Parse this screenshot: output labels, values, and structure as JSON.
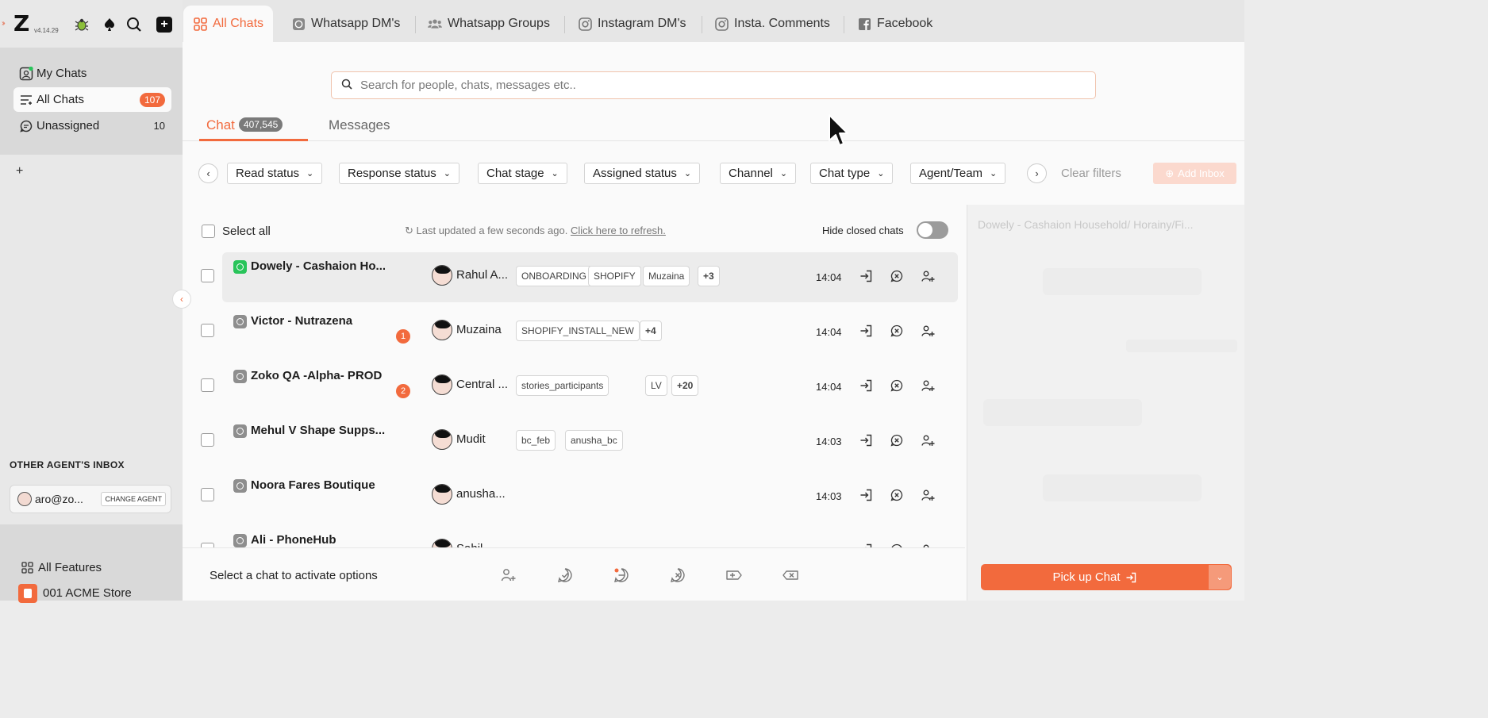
{
  "app": {
    "version": "v4.14.29",
    "accent": "#f26a3d"
  },
  "tabs": [
    {
      "label": "All Chats",
      "icon": "grid-icon",
      "active": true
    },
    {
      "label": "Whatsapp DM's",
      "icon": "whatsapp-icon"
    },
    {
      "label": "Whatsapp Groups",
      "icon": "group-icon"
    },
    {
      "label": "Instagram DM's",
      "icon": "instagram-icon"
    },
    {
      "label": "Insta. Comments",
      "icon": "instagram-icon"
    },
    {
      "label": "Facebook",
      "icon": "facebook-icon"
    }
  ],
  "sidebar": {
    "items": [
      {
        "label": "My Chats",
        "count": ""
      },
      {
        "label": "All Chats",
        "count": "107"
      },
      {
        "label": "Unassigned",
        "count": "10"
      }
    ],
    "add_label": "+",
    "other_inbox_title": "OTHER AGENT'S INBOX",
    "agent_email": "aro@zo...",
    "change_agent": "CHANGE AGENT",
    "all_features": "All Features",
    "store": "001 ACME Store"
  },
  "search": {
    "placeholder": "Search for people, chats, messages etc.."
  },
  "subtabs": {
    "chat": "Chat",
    "chat_count": "407,545",
    "messages": "Messages"
  },
  "filters": {
    "items": [
      "Read status",
      "Response status",
      "Chat stage",
      "Assigned status",
      "Channel",
      "Chat type",
      "Agent/Team"
    ],
    "clear": "Clear filters",
    "add_inbox": "Add Inbox"
  },
  "list": {
    "select_all": "Select all",
    "last_updated": "Last updated a few seconds ago.",
    "refresh": "Click here to refresh.",
    "hide_closed": "Hide closed chats"
  },
  "rows": [
    {
      "name": "Dowely - Cashaion Ho...",
      "channel": "whatsapp",
      "unread": "",
      "agent": "Rahul A...",
      "tags": [
        "ONBOARDING",
        "SHOPIFY",
        "Muzaina",
        "+3"
      ],
      "time": "14:04"
    },
    {
      "name": "Victor - Nutrazena",
      "channel": "whatsapp-grey",
      "unread": "1",
      "agent": "Muzaina",
      "tags": [
        "SHOPIFY_INSTALL_NEW",
        "+4"
      ],
      "time": "14:04"
    },
    {
      "name": "Zoko QA -Alpha- PROD",
      "channel": "whatsapp-grey",
      "unread": "2",
      "agent": "Central ...",
      "tags": [
        "stories_participants",
        "LV",
        "+20"
      ],
      "time": "14:04"
    },
    {
      "name": "Mehul V Shape Supps...",
      "channel": "whatsapp-grey",
      "unread": "",
      "agent": "Mudit",
      "tags": [
        "bc_feb",
        "anusha_bc"
      ],
      "time": "14:03"
    },
    {
      "name": "Noora Fares Boutique",
      "channel": "whatsapp-grey",
      "unread": "",
      "agent": "anusha...",
      "tags": [],
      "time": "14:03"
    },
    {
      "name": "Ali - PhoneHub",
      "channel": "whatsapp-grey",
      "unread": "",
      "agent": "Sahil",
      "tags": [],
      "time": ""
    }
  ],
  "bottom": {
    "hint": "Select a chat to activate options"
  },
  "right_pane": {
    "title": "Dowely - Cashaion Household/ Horainy/Fi...",
    "pickup": "Pick up Chat"
  }
}
